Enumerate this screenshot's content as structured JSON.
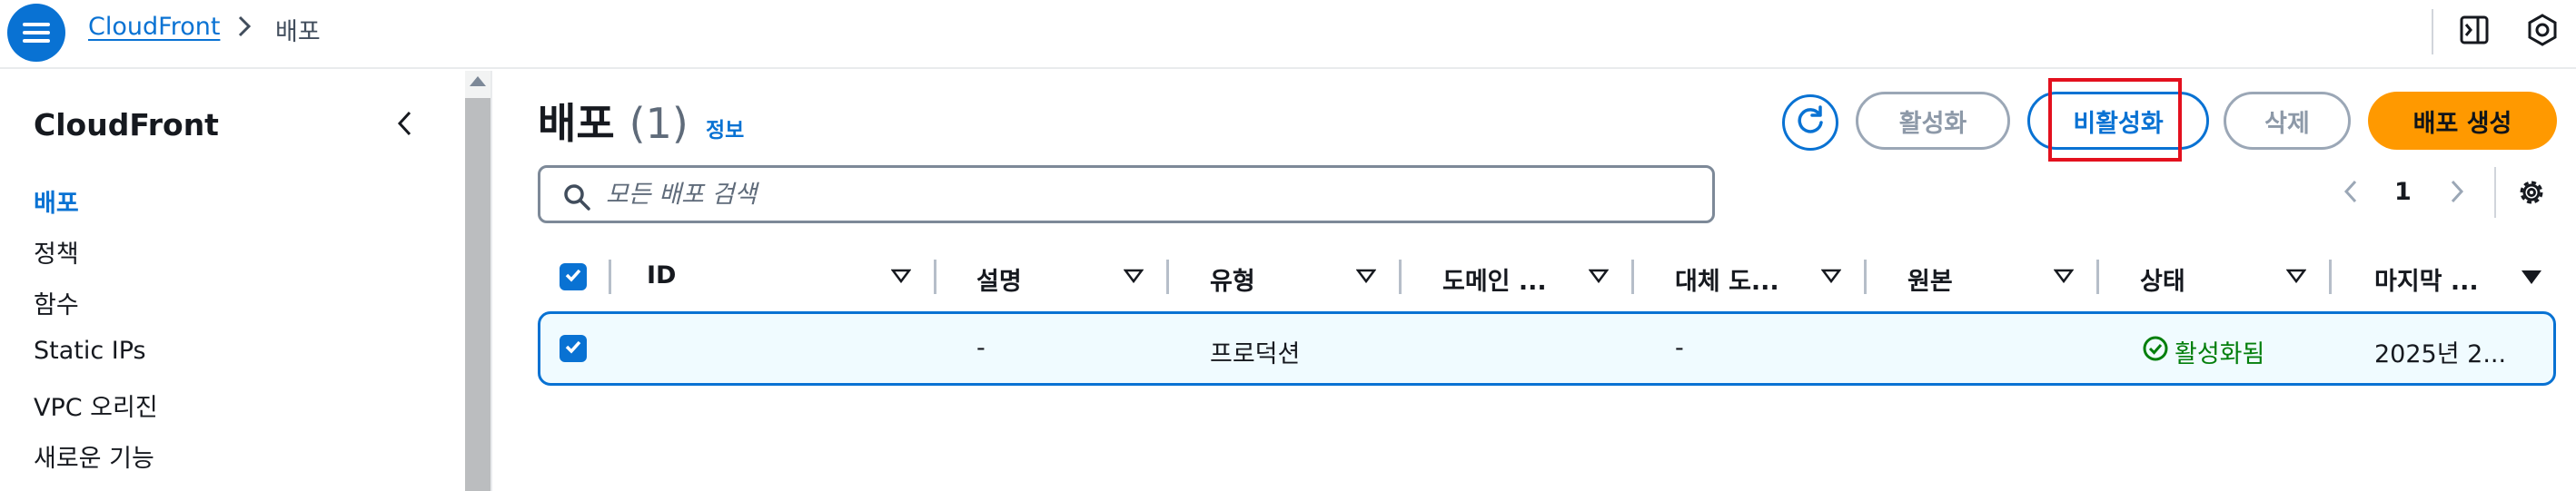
{
  "breadcrumb": {
    "service": "CloudFront",
    "current": "배포"
  },
  "sidebar": {
    "title": "CloudFront",
    "items": [
      {
        "label": "배포",
        "active": true
      },
      {
        "label": "정책",
        "active": false
      },
      {
        "label": "함수",
        "active": false
      },
      {
        "label": "Static IPs",
        "active": false
      },
      {
        "label": "VPC 오리진",
        "active": false
      },
      {
        "label": "새로운 기능",
        "active": false
      }
    ]
  },
  "header": {
    "title": "배포",
    "count": "(1)",
    "info": "정보",
    "buttons": {
      "enable": "활성화",
      "disable": "비활성화",
      "delete": "삭제",
      "create": "배포 생성"
    }
  },
  "search": {
    "placeholder": "모든 배포 검색",
    "value": ""
  },
  "pagination": {
    "page": "1"
  },
  "table": {
    "columns": [
      "ID",
      "설명",
      "유형",
      "도메인 ...",
      "대체 도...",
      "원본",
      "상태",
      "마지막 ..."
    ],
    "rows": [
      {
        "selected": true,
        "id": "",
        "description": "-",
        "type": "프로덕션",
        "domain": "",
        "alternate": "-",
        "origin": "",
        "status": "활성화됨",
        "last_modified": "2025년 2..."
      }
    ]
  },
  "colors": {
    "accent": "#0972d3",
    "primary_button": "#ff9900",
    "status_ok": "#037f0c",
    "highlight": "#e3101e"
  },
  "icons": [
    "menu-icon",
    "chevron-right-icon",
    "notifications-panel-icon",
    "settings-hex-icon",
    "chevron-left-icon",
    "refresh-icon",
    "search-icon",
    "settings-gear-icon",
    "sort-icon",
    "check-icon",
    "status-success-icon"
  ]
}
